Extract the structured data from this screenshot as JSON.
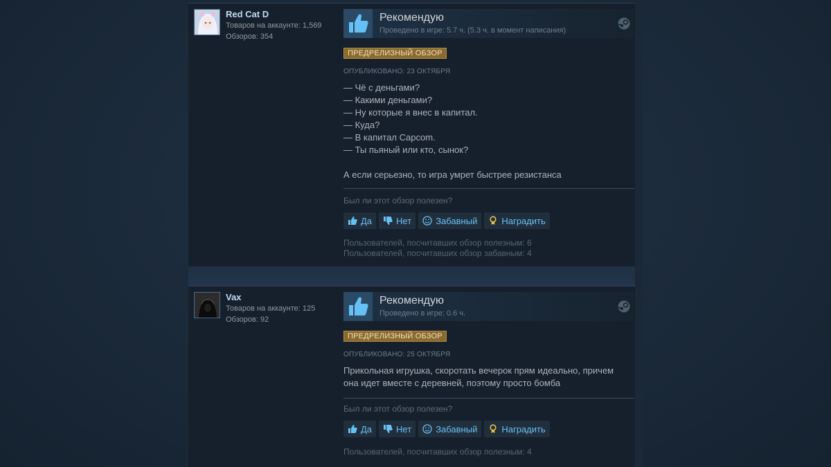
{
  "reviews": [
    {
      "author": {
        "name": "Red Cat D",
        "products": "Товаров на аккаунте: 1,569",
        "reviews": "Обзоров: 354"
      },
      "vote": {
        "title": "Рекомендую",
        "hours": "Проведено в игре: 5.7 ч. (5.3 ч. в момент написания)"
      },
      "badge": "ПРЕДРЕЛИЗНЫЙ ОБЗОР",
      "posted": "ОПУБЛИКОВАНО: 23 ОКТЯБРЯ",
      "lines": [
        "— Чё с деньгами?",
        "— Какими деньгами?",
        "— Ну которые я внес в капитал.",
        "— Куда?",
        "— В капитал Capcom.",
        "— Ты пьяный или кто, сынок?",
        "",
        "А если серьезно, то игра умрет быстрее резистанса"
      ],
      "helpful_question": "Был ли этот обзор полезен?",
      "buttons": {
        "yes": "Да",
        "no": "Нет",
        "funny": "Забавный",
        "award": "Наградить"
      },
      "counts": [
        "Пользователей, посчитавших обзор полезным: 6",
        "Пользователей, посчитавших обзор забавным: 4"
      ]
    },
    {
      "author": {
        "name": "Vax",
        "products": "Товаров на аккаунте: 125",
        "reviews": "Обзоров: 92"
      },
      "vote": {
        "title": "Рекомендую",
        "hours": "Проведено в игре: 0.6 ч."
      },
      "badge": "ПРЕДРЕЛИЗНЫЙ ОБЗОР",
      "posted": "ОПУБЛИКОВАНО: 25 ОКТЯБРЯ",
      "lines": [
        "Прикольная игрушка, скоротать вечерок прям идеально, причем",
        "она идет вместе с деревней, поэтому просто бомба"
      ],
      "helpful_question": "Был ли этот обзор полезен?",
      "buttons": {
        "yes": "Да",
        "no": "Нет",
        "funny": "Забавный",
        "award": "Наградить"
      },
      "counts": [
        "Пользователей, посчитавших обзор полезным: 4"
      ]
    }
  ],
  "icons": {
    "thumb": "thumbs-up-icon",
    "steam": "steam-icon",
    "yes": "thumbs-up-small-icon",
    "no": "thumbs-down-icon",
    "funny": "smiley-icon",
    "award": "award-icon"
  },
  "colors": {
    "link": "#67c1f5",
    "badge_bg": "#8a6a2f",
    "thumb_blue": "#66c0f4"
  }
}
